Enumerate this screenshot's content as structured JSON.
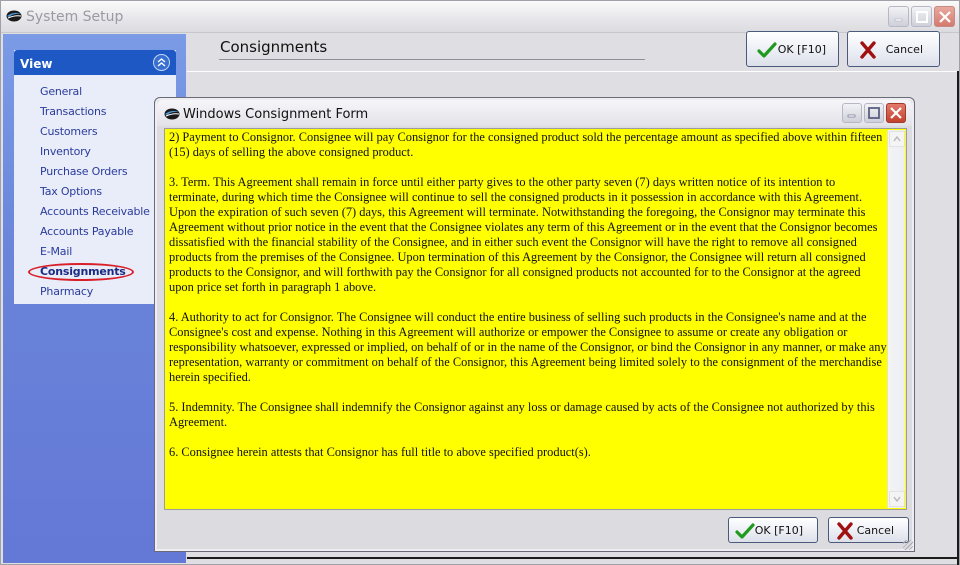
{
  "window": {
    "title": "System Setup",
    "controls": [
      "minimize",
      "maximize",
      "close"
    ]
  },
  "sidebar": {
    "section_title": "View",
    "items": [
      {
        "label": "General",
        "active": false
      },
      {
        "label": "Transactions",
        "active": false
      },
      {
        "label": "Customers",
        "active": false
      },
      {
        "label": "Inventory",
        "active": false
      },
      {
        "label": "Purchase Orders",
        "active": false
      },
      {
        "label": "Tax Options",
        "active": false
      },
      {
        "label": "Accounts Receivable",
        "active": false
      },
      {
        "label": "Accounts Payable",
        "active": false
      },
      {
        "label": "E-Mail",
        "active": false
      },
      {
        "label": "Consignments",
        "active": true
      },
      {
        "label": "Pharmacy",
        "active": false
      }
    ]
  },
  "header": {
    "title": "Consignments",
    "ok_label": "OK [F10]",
    "cancel_label": "Cancel"
  },
  "dialog": {
    "title": "Windows Consignment Form",
    "paragraphs": [
      "2)  Payment to Consignor.  Consignee will pay Consignor for the consigned product sold the percentage amount as specified above within fifteen (15) days of selling the above consigned product.",
      "3.  Term.  This Agreement shall remain in force until either party gives to the other party seven (7) days written notice of its intention to terminate, during which time the Consignee will continue to sell the consigned products in it possession in accordance with this Agreement.  Upon the expiration of such seven (7) days, this Agreement will terminate.  Notwithstanding the foregoing, the Consignor may terminate this Agreement without prior notice in the event that the Consignee violates any term of this Agreement or in the event that the Consignor becomes dissatisfied with the financial stability of the Consignee, and in either such event the Consignor will have the right to remove all consigned products from the premises of the Consignee.  Upon termination of this Agreement by the Consignor, the Consignee will return all consigned products to the Consignor, and will forthwith pay the Consignor for all consigned products not accounted for to the Consignor at the agreed upon price set forth in paragraph 1 above.",
      "4.  Authority to act for Consignor.  The Consignee will conduct the entire business of selling such products in the Consignee's name and at the Consignee's cost and expense.  Nothing in this Agreement will authorize or empower the Consignee to assume or create any obligation or responsibility whatsoever, expressed or implied, on behalf of or in the name of the Consignor, or bind the Consignor in any manner, or make any representation, warranty or commitment on behalf of the Consignor, this Agreement being limited solely to the consignment of the merchandise herein specified.",
      "5.  Indemnity.  The Consignee shall indemnify the Consignor against any loss or damage caused by acts of the Consignee not authorized by this Agreement.",
      "6.  Consignee herein attests that Consignor has full title to above specified product(s)."
    ],
    "ok_label": "OK [F10]",
    "cancel_label": "Cancel"
  },
  "colors": {
    "sidebar_header": "#1e58c4",
    "sidebar_bg": "#6a85da",
    "text_area_bg": "#ffff00",
    "highlight_ring": "#d8202a",
    "ok_check": "#1f9a1f",
    "cancel_x": "#a01010"
  }
}
